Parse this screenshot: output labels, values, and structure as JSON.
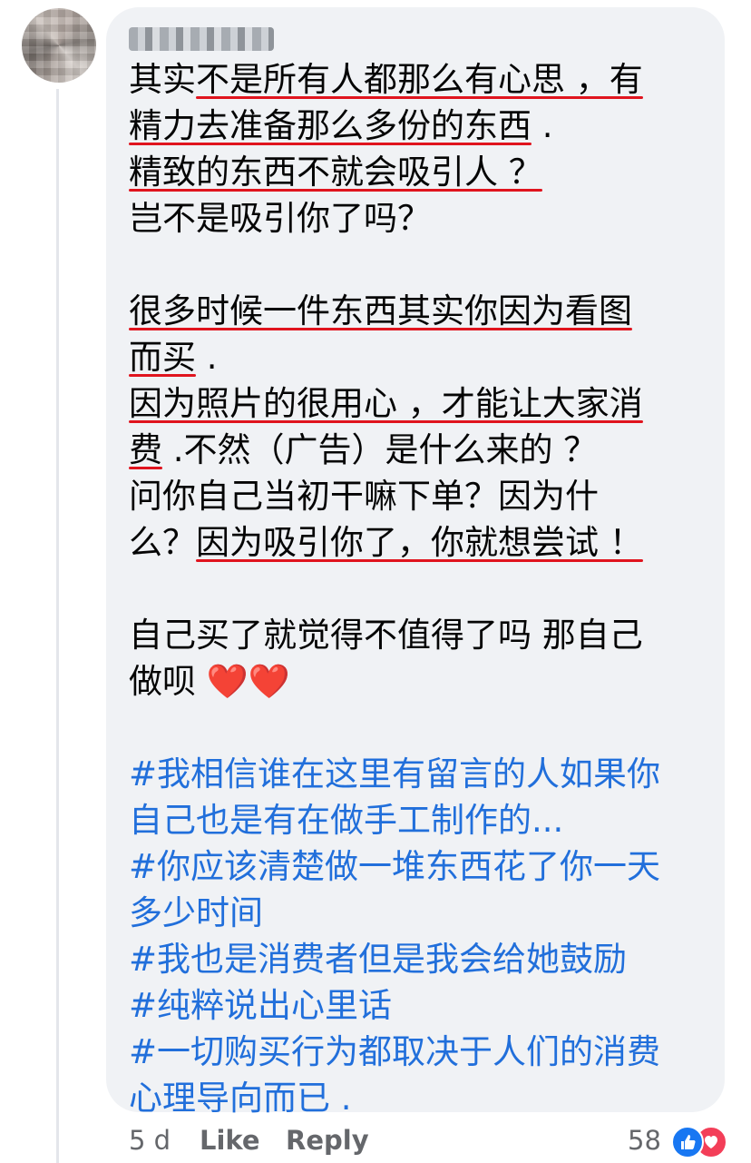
{
  "comment": {
    "lines": [
      {
        "segs": [
          {
            "t": "其实"
          },
          {
            "t": "不是所有人都那么有心思 ，有",
            "u": true
          }
        ]
      },
      {
        "segs": [
          {
            "t": "精力去准备那么多份的东西",
            "u": true
          },
          {
            "t": " ."
          }
        ]
      },
      {
        "segs": [
          {
            "t": "精致的东西不就会吸引人 ？",
            "u": true
          }
        ]
      },
      {
        "segs": [
          {
            "t": "岂不是吸引你了吗？"
          }
        ]
      },
      {
        "blank": true
      },
      {
        "segs": [
          {
            "t": "很多时候一件东西其实你因为看图",
            "u": true
          }
        ]
      },
      {
        "segs": [
          {
            "t": "而买",
            "u": true
          },
          {
            "t": " ."
          }
        ]
      },
      {
        "segs": [
          {
            "t": "因为照片的很用心 ，才能让大家消",
            "u": true
          }
        ]
      },
      {
        "segs": [
          {
            "t": "费",
            "u": true
          },
          {
            "t": " .不然（广告）是什么来的 ？"
          }
        ]
      },
      {
        "segs": [
          {
            "t": "问你自己当初干嘛下单？因为什"
          }
        ]
      },
      {
        "segs": [
          {
            "t": "么？"
          },
          {
            "t": "因为吸引你了，你就想尝试 ！",
            "u": true
          }
        ]
      },
      {
        "blank": true
      },
      {
        "segs": [
          {
            "t": "自己买了就觉得不值得了吗 那自己"
          }
        ]
      },
      {
        "segs": [
          {
            "t": "做呗 "
          },
          {
            "t": "❤️❤️",
            "heart": true
          }
        ]
      },
      {
        "blank": true
      },
      {
        "segs": [
          {
            "t": "#我相信谁在这里有留言的人如果你",
            "h": true
          }
        ]
      },
      {
        "segs": [
          {
            "t": "自己也是有在做手工制作的...",
            "h": true
          }
        ]
      },
      {
        "segs": [
          {
            "t": "#你应该清楚做一堆东西花了你一天",
            "h": true
          }
        ]
      },
      {
        "segs": [
          {
            "t": "多少时间",
            "h": true
          }
        ]
      },
      {
        "segs": [
          {
            "t": "#我也是消费者但是我会给她鼓励",
            "h": true
          }
        ]
      },
      {
        "segs": [
          {
            "t": "#纯粹说出心里话",
            "h": true
          }
        ]
      },
      {
        "segs": [
          {
            "t": "#一切购买行为都取决于人们的消费",
            "h": true
          }
        ]
      },
      {
        "segs": [
          {
            "t": "心理导向而已 .",
            "h": true
          }
        ]
      }
    ]
  },
  "footer": {
    "timestamp": "5 d",
    "like_label": "Like",
    "reply_label": "Reply",
    "reaction_count": "58"
  },
  "icons": {
    "like_reaction": "thumbs-up-icon",
    "love_reaction": "heart-icon"
  },
  "colors": {
    "bubble": "#f0f2f5",
    "text": "#050505",
    "hashtag": "#216fdb",
    "underline": "#e0141e",
    "muted": "#65676b",
    "like_blue": "#1877f2",
    "love_red": "#f33e58"
  }
}
